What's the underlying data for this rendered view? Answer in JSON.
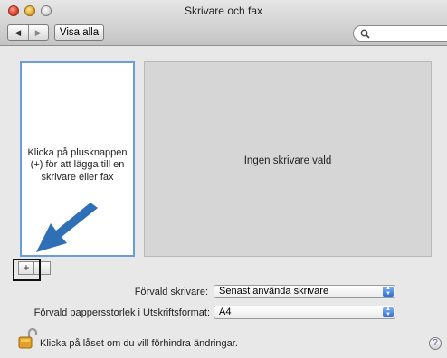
{
  "window": {
    "title": "Skrivare och fax"
  },
  "toolbar": {
    "back_icon": "◀",
    "forward_icon": "▶",
    "show_all_label": "Visa alla",
    "search_placeholder": ""
  },
  "printer_list": {
    "empty_hint": "Klicka på plusknappen (+) för att lägga till en skrivare eller fax",
    "add_label": "+",
    "remove_label": ""
  },
  "detail": {
    "message": "Ingen skrivare vald"
  },
  "settings": {
    "default_printer_label": "Förvald skrivare:",
    "default_printer_value": "Senast använda skrivare",
    "default_paper_label": "Förvald pappersstorlek i Utskriftsformat:",
    "default_paper_value": "A4"
  },
  "footer": {
    "lock_text": "Klicka på låset om du vill förhindra ändringar.",
    "help_label": "?"
  },
  "colors": {
    "selection_border": "#6b9ddb",
    "annotation_arrow": "#2f6fb6"
  }
}
